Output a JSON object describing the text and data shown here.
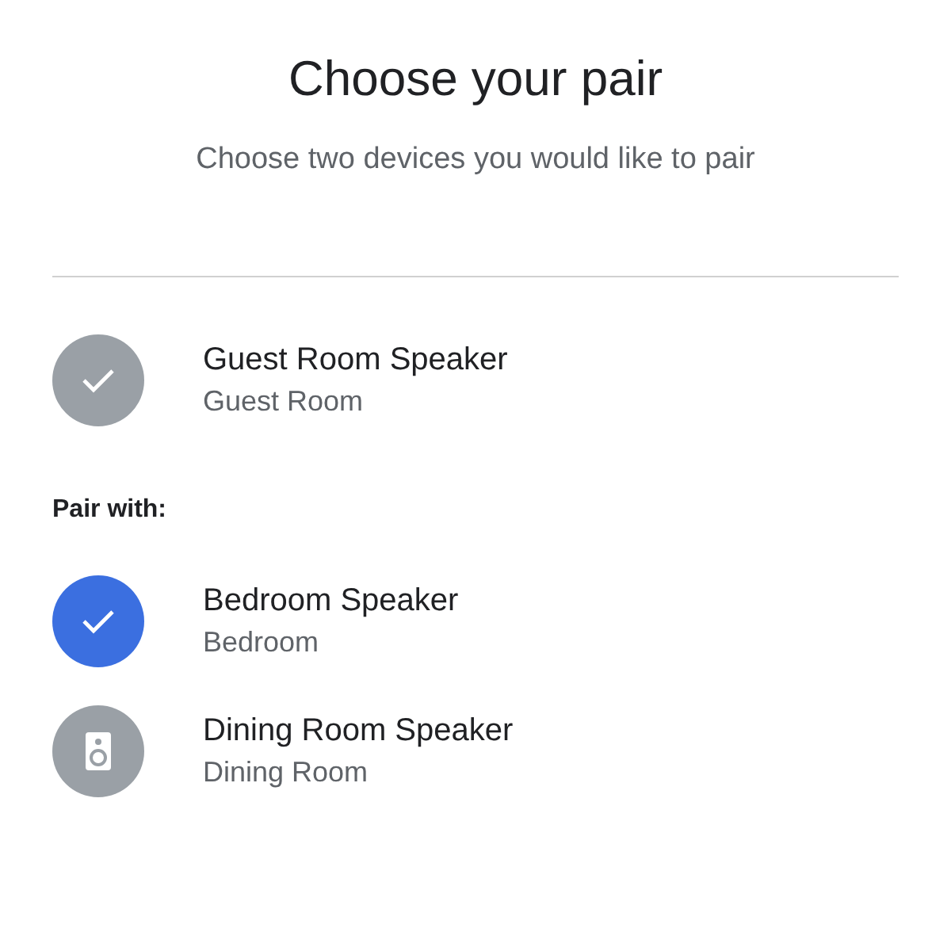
{
  "title": "Choose your pair",
  "subtitle": "Choose two devices you would like to pair",
  "primary": {
    "name": "Guest Room Speaker",
    "room": "Guest Room"
  },
  "pair_label": "Pair with:",
  "devices": [
    {
      "name": "Bedroom Speaker",
      "room": "Bedroom",
      "selected": true
    },
    {
      "name": "Dining Room Speaker",
      "room": "Dining Room",
      "selected": false
    }
  ]
}
